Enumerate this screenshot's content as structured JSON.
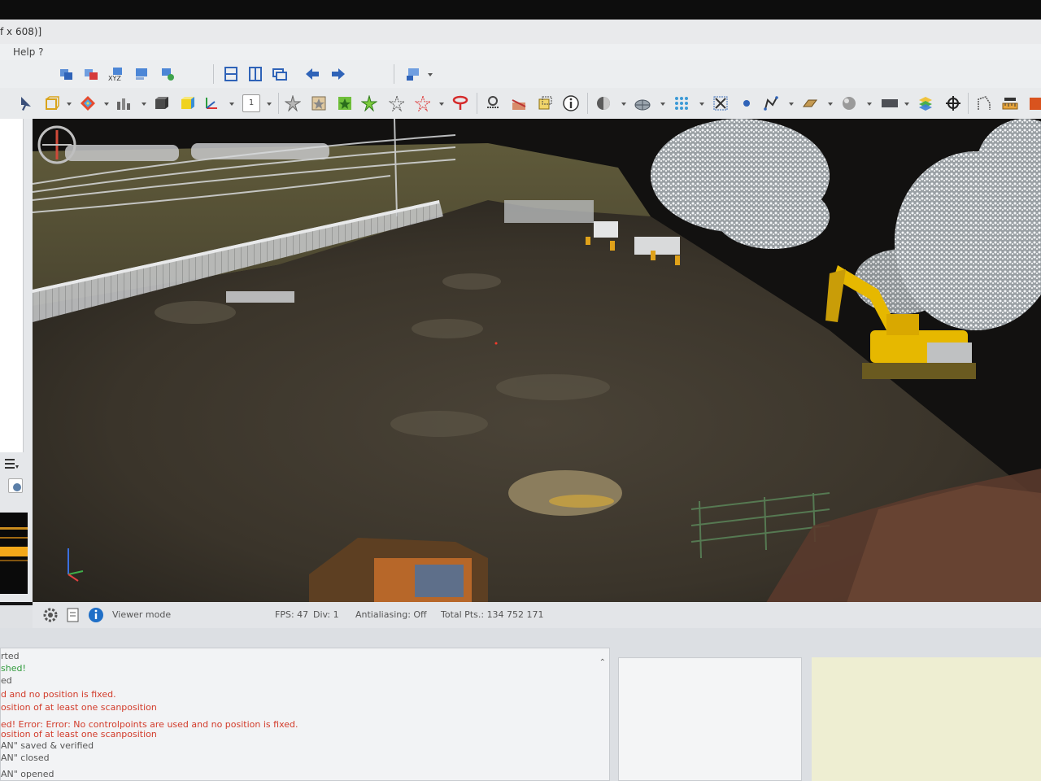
{
  "window": {
    "title_fragment": "f x 608)]"
  },
  "menubar": {
    "items": [
      "Help ?"
    ]
  },
  "statusbar": {
    "mode": "Viewer mode",
    "fps": "FPS: 47",
    "div": "Div: 1",
    "antialiasing": "Antialiasing: Off",
    "total_points": "Total Pts.: 134 752 171"
  },
  "console": {
    "lines": [
      {
        "text": "rted",
        "color": "#555555"
      },
      {
        "text": "shed!",
        "color": "#2f9a3a"
      },
      {
        "text": "ed",
        "color": "#555555"
      },
      {
        "text": "d and no position is fixed.",
        "color": "#d23b2a"
      },
      {
        "text": "osition of at least one scanposition",
        "color": "#d23b2a"
      },
      {
        "text": "ed! Error: Error: No controlpoints are used and no position is fixed.",
        "color": "#d23b2a"
      },
      {
        "text": "osition of at least one scanposition",
        "color": "#d23b2a"
      },
      {
        "text": "AN\" saved & verified",
        "color": "#555555"
      },
      {
        "text": "AN\" closed",
        "color": "#555555"
      },
      {
        "text": "AN\" opened",
        "color": "#555555"
      }
    ]
  },
  "toolbar1": {
    "icons": [
      "merge-clouds-icon",
      "scan-positions-icon",
      "xyz-coordinates-icon",
      "registration-icon",
      "align-icon",
      "layout-split-h-icon",
      "layout-split-v-icon",
      "layout-window-icon",
      "undo-icon",
      "redo-icon",
      "view-settings-icon"
    ]
  },
  "toolbar2": {
    "icons": [
      "select-tool-icon",
      "box-icon",
      "color-scale-icon",
      "distance-histogram-icon",
      "solid-cube-icon",
      "yellow-cube-icon",
      "axis-icon",
      "page-number-icon",
      "point-pick-icon",
      "segment-icon",
      "segment-in-icon",
      "segment-out-icon",
      "crop-icon",
      "crop-sub-icon",
      "filter-icon",
      "cross-section-icon",
      "profile-icon",
      "bounding-box-icon",
      "info-icon",
      "shader-icon",
      "mesh-icon",
      "grid-icon",
      "crosshair-icon",
      "point-icon",
      "trace-polyline-icon",
      "plane-icon",
      "sphere-icon",
      "rectangle-icon",
      "layers-icon",
      "target-icon",
      "measure-icon",
      "ruler-icon",
      "export-icon"
    ],
    "page_number": "1"
  },
  "colors": {
    "toolbar_bg": "#eceef0",
    "error_text": "#d23b2a",
    "success_text": "#2f9a3a",
    "info_blue": "#1f6fc7",
    "excavator_yellow": "#e6b800"
  }
}
